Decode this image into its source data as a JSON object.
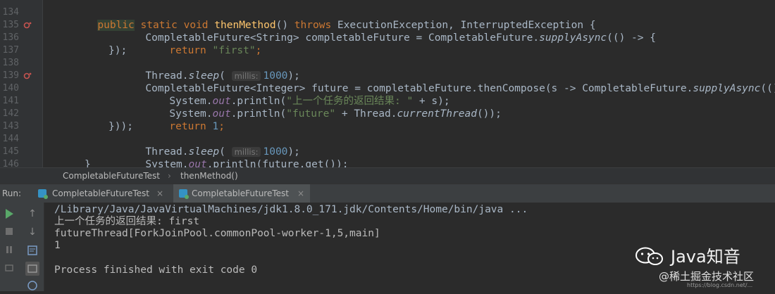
{
  "editor": {
    "lines": [
      {
        "num": "134"
      },
      {
        "num": "135"
      },
      {
        "num": "136"
      },
      {
        "num": "137"
      },
      {
        "num": "138"
      },
      {
        "num": "139"
      },
      {
        "num": "140"
      },
      {
        "num": "141"
      },
      {
        "num": "142"
      },
      {
        "num": "143"
      },
      {
        "num": "144"
      },
      {
        "num": "145"
      },
      {
        "num": "146"
      }
    ],
    "code": {
      "l134_public": "public",
      "l134_static": " static void ",
      "l134_method": "thenMethod",
      "l134_throws_pre": "() ",
      "l134_throws": "throws",
      "l134_rest": " ExecutionException, InterruptedException {",
      "l135_a": "CompletableFuture<String> completableFuture = CompletableFuture.",
      "l135_b": "supplyAsync",
      "l135_c": "(() -> {",
      "l136_kw": "return",
      "l136_str": " \"first\"",
      "l136_end": ";",
      "l137": "});",
      "l138_a": "Thread.",
      "l138_b": "sleep",
      "l138_c": "( ",
      "l138_hint": "millis:",
      "l138_num": "1000",
      "l138_d": ");",
      "l139_a": "CompletableFuture<Integer> future = completableFuture.thenCompose(s -> CompletableFuture.",
      "l139_b": "supplyAsync",
      "l139_c": "(() -> {",
      "l140_a": "System.",
      "l140_out": "out",
      "l140_b": ".println(",
      "l140_str": "\"上一个任务的返回结果: \"",
      "l140_c": " + s);",
      "l141_a": "System.",
      "l141_out": "out",
      "l141_b": ".println(",
      "l141_str": "\"future\"",
      "l141_c": " + Thread.",
      "l141_d": "currentThread",
      "l141_e": "());",
      "l142_kw": "return",
      "l142_num": " 1",
      "l142_end": ";",
      "l143": "}));",
      "l144_a": "Thread.",
      "l144_b": "sleep",
      "l144_c": "( ",
      "l144_hint": "millis:",
      "l144_num": "1000",
      "l144_d": ");",
      "l145_a": "System.",
      "l145_out": "out",
      "l145_b": ".println(future.get());",
      "l146": "}"
    }
  },
  "breadcrumb": {
    "class_name": "CompletableFutureTest",
    "method_name": "thenMethod()"
  },
  "run_panel": {
    "label": "Run:",
    "tabs": [
      {
        "label": "CompletableFutureTest",
        "close": "×"
      },
      {
        "label": "CompletableFutureTest",
        "close": "×"
      }
    ]
  },
  "console": {
    "lines": [
      "/Library/Java/JavaVirtualMachines/jdk1.8.0_171.jdk/Contents/Home/bin/java ...",
      "上一个任务的返回结果: first",
      "futureThread[ForkJoinPool.commonPool-worker-1,5,main]",
      "1",
      "",
      "Process finished with exit code 0"
    ]
  },
  "watermark": {
    "brand": "Java知音",
    "site": "@稀土掘金技术社区",
    "small_url": "https://blog.csdn.net/..."
  },
  "colors": {
    "keyword": "#cc7832",
    "method_decl": "#ffc66d",
    "string": "#6a8759",
    "number": "#6897bb",
    "static_field": "#9876aa",
    "run_green": "#59a869"
  }
}
